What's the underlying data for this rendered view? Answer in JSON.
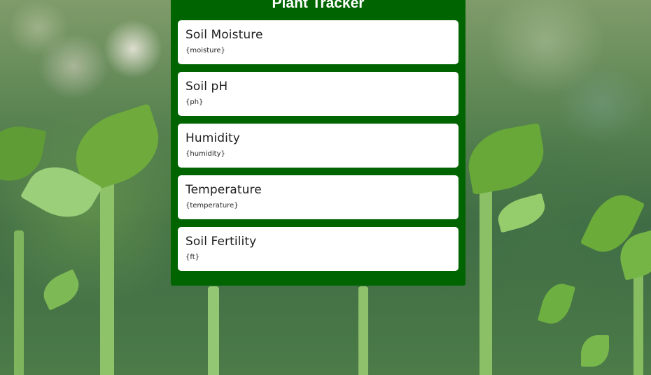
{
  "app": {
    "title": "Plant Tracker"
  },
  "cards": [
    {
      "title": "Soil Moisture",
      "value": "{moisture}"
    },
    {
      "title": "Soil pH",
      "value": "{ph}"
    },
    {
      "title": "Humidity",
      "value": "{humidity}"
    },
    {
      "title": "Temperature",
      "value": "{temperature}"
    },
    {
      "title": "Soil Fertility",
      "value": "{ft}"
    }
  ],
  "colors": {
    "panel": "#006400",
    "card": "#ffffff",
    "title_text": "#ffffff"
  }
}
